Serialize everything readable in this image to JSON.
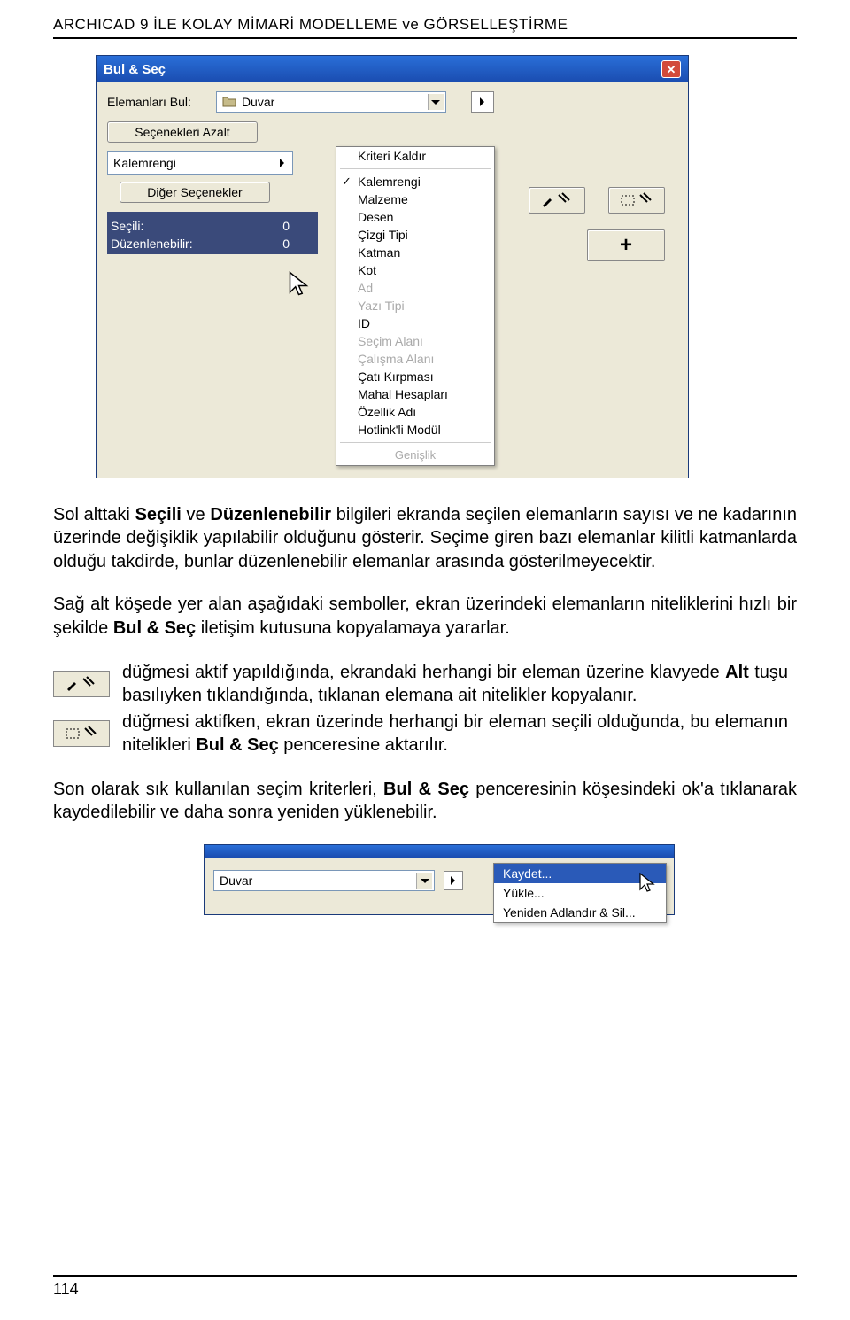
{
  "header": "ARCHICAD 9 İLE KOLAY MİMARİ MODELLEME ve GÖRSELLEŞTİRME",
  "dialog1": {
    "title": "Bul & Seç",
    "find_label": "Elemanları Bul:",
    "element_type": "Duvar",
    "reduce_options": "Seçenekleri Azalt",
    "pen_color": "Kalemrengi",
    "other_options": "Diğer Seçenekler",
    "status": {
      "selected_label": "Seçili:",
      "selected_value": "0",
      "editable_label": "Düzenlenebilir:",
      "editable_value": "0"
    },
    "menu_header": "Kriteri Kaldır",
    "menu_items": [
      {
        "label": "Kalemrengi",
        "checked": true,
        "disabled": false
      },
      {
        "label": "Malzeme",
        "checked": false,
        "disabled": false
      },
      {
        "label": "Desen",
        "checked": false,
        "disabled": false
      },
      {
        "label": "Çizgi Tipi",
        "checked": false,
        "disabled": false
      },
      {
        "label": "Katman",
        "checked": false,
        "disabled": false
      },
      {
        "label": "Kot",
        "checked": false,
        "disabled": false
      },
      {
        "label": "Ad",
        "checked": false,
        "disabled": true
      },
      {
        "label": "Yazı Tipi",
        "checked": false,
        "disabled": true
      },
      {
        "label": "ID",
        "checked": false,
        "disabled": false
      },
      {
        "label": "Seçim Alanı",
        "checked": false,
        "disabled": true
      },
      {
        "label": "Çalışma Alanı",
        "checked": false,
        "disabled": true
      },
      {
        "label": "Çatı Kırpması",
        "checked": false,
        "disabled": false
      },
      {
        "label": "Mahal Hesapları",
        "checked": false,
        "disabled": false
      },
      {
        "label": "Özellik Adı",
        "checked": false,
        "disabled": false
      },
      {
        "label": "Hotlink'li Modül",
        "checked": false,
        "disabled": false
      }
    ],
    "menu_more": "Genişlik",
    "plus": "+"
  },
  "paragraphs": {
    "p1_pre": "Sol alttaki ",
    "p1_b1": "Seçili",
    "p1_mid1": " ve ",
    "p1_b2": "Düzenlenebilir",
    "p1_post": " bilgileri ekranda seçilen elemanların sayısı ve ne kadarının üzerinde değişiklik yapılabilir olduğunu gösterir. Seçime giren bazı elemanlar kilitli katmanlarda olduğu takdirde, bunlar düzenlenebilir elemanlar arasında gösterilmeyecektir.",
    "p2_pre": "Sağ alt köşede yer alan aşağıdaki semboller, ekran üzerindeki elemanların niteliklerini hızlı bir şekilde ",
    "p2_b": "Bul & Seç",
    "p2_post": " iletişim kutusuna kopyalamaya yararlar.",
    "row1_pre": "düğmesi aktif yapıldığında, ekrandaki herhangi bir eleman üzerine klavyede ",
    "row1_b": "Alt",
    "row1_post": " tuşu basılıyken tıklandığında, tıklanan elemana ait nitelikler kopyalanır.",
    "row2_pre": "düğmesi aktifken, ekran üzerinde herhangi bir eleman seçili olduğunda, bu elemanın nitelikleri ",
    "row2_b": "Bul & Seç",
    "row2_post": " penceresine aktarılır.",
    "p3_pre": "Son olarak sık kullanılan seçim kriterleri, ",
    "p3_b": "Bul & Seç",
    "p3_post": " penceresinin köşesindeki ok'a tıklanarak kaydedilebilir ve daha sonra yeniden yüklenebilir."
  },
  "dialog2": {
    "combo_value": "Duvar",
    "menu": {
      "save": "Kaydet...",
      "load": "Yükle...",
      "rename": "Yeniden Adlandır & Sil..."
    }
  },
  "page_number": "114"
}
